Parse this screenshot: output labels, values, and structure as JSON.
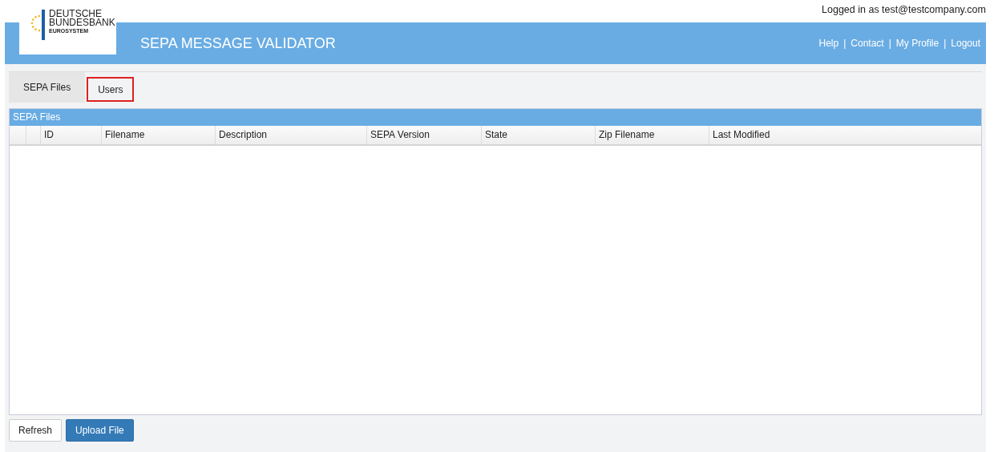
{
  "user_line": "Logged in as test@testcompany.com",
  "logo": {
    "lines": [
      "DEUTSCHE",
      "BUNDESBANK",
      "EUROSYSTEM"
    ]
  },
  "header": {
    "title": "SEPA MESSAGE VALIDATOR",
    "links": [
      "Help",
      "Contact",
      "My Profile",
      "Logout"
    ],
    "separator": "|"
  },
  "tabs": [
    {
      "label": "SEPA Files",
      "selected": true,
      "highlighted": false
    },
    {
      "label": "Users",
      "selected": false,
      "highlighted": true
    }
  ],
  "table": {
    "title": "SEPA Files",
    "columns": [
      "ID",
      "Filename",
      "Description",
      "SEPA Version",
      "State",
      "Zip Filename",
      "Last Modified"
    ]
  },
  "buttons": [
    {
      "label": "Refresh",
      "kind": "default"
    },
    {
      "label": "Upload File",
      "kind": "primary"
    }
  ]
}
